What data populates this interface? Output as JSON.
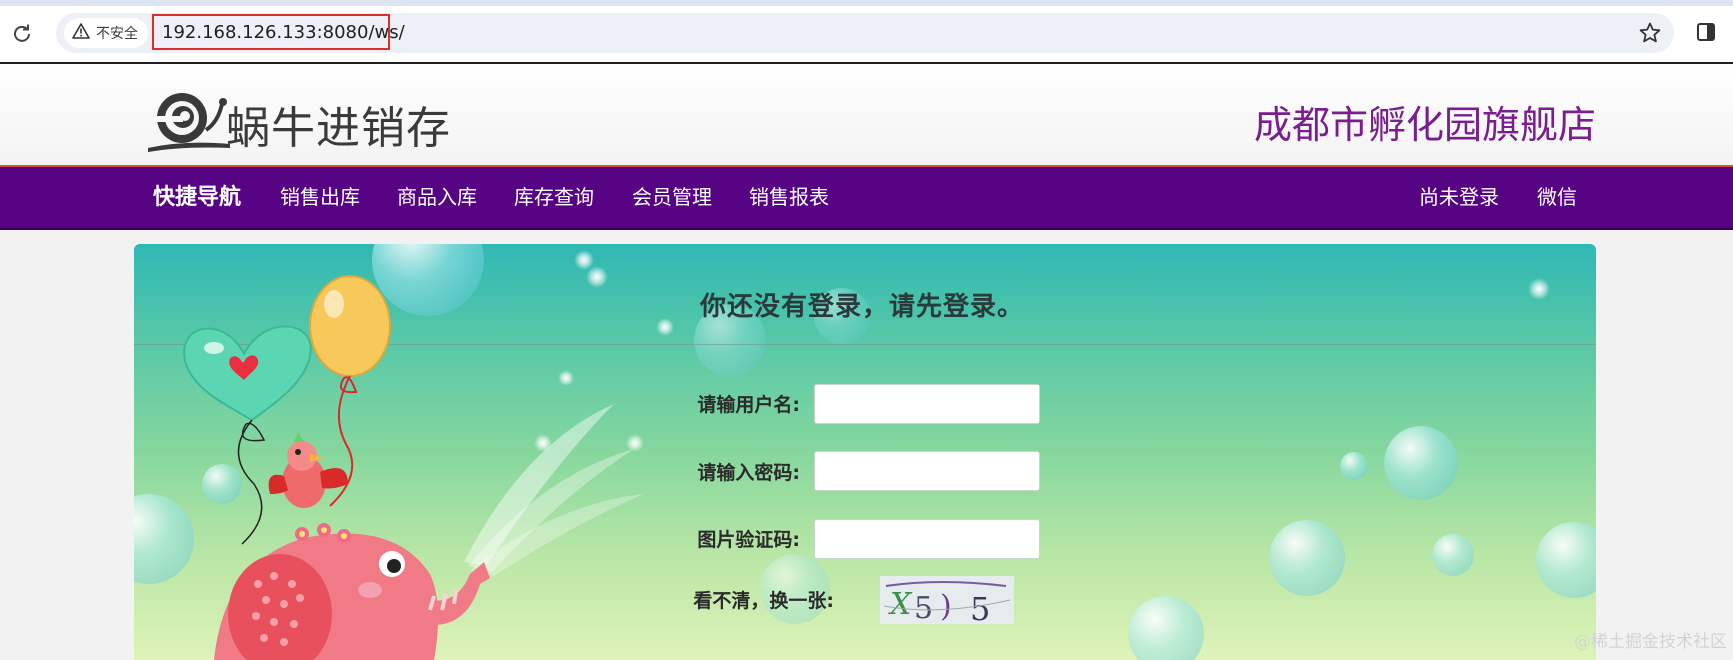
{
  "browser": {
    "security_label": "不安全",
    "url": "192.168.126.133:8080/ws/"
  },
  "header": {
    "logo_text": "蜗牛进销存",
    "store_name": "成都市孵化园旗舰店"
  },
  "nav": {
    "brand": "快捷导航",
    "items": [
      "销售出库",
      "商品入库",
      "库存查询",
      "会员管理",
      "销售报表"
    ],
    "right_items": [
      "尚未登录",
      "微信"
    ]
  },
  "login": {
    "title": "你还没有登录，请先登录。",
    "username_label": "请输用户名:",
    "password_label": "请输入密码:",
    "captcha_label": "图片验证码:",
    "refresh_label": "看不清，换一张:",
    "username_value": "",
    "password_value": "",
    "captcha_value": "",
    "captcha_image_text": "X5)5"
  },
  "watermark": "@稀土掘金技术社区",
  "colors": {
    "nav_bg": "#560384",
    "store_name": "#7a1d8f",
    "url_highlight": "#d9302b"
  }
}
